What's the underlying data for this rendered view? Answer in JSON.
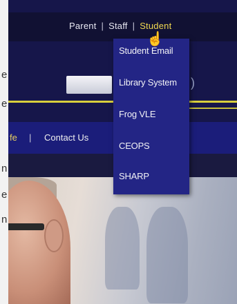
{
  "top_links": {
    "parent": "Parent",
    "staff": "Staff",
    "student": "Student",
    "separator": "|"
  },
  "dropdown": {
    "items": [
      "Student Email",
      "Library System",
      "Frog VLE",
      "CEOPS",
      "SHARP"
    ]
  },
  "nav": {
    "partial_item": "fe",
    "separator": "|",
    "contact": "Contact Us"
  },
  "left_margin_letters": [
    "e",
    "e",
    "n",
    "e",
    "n"
  ],
  "colors": {
    "header_bg": "#16164a",
    "nav_bg": "#1b1d7a",
    "dropdown_bg": "#232585",
    "accent_yellow": "#d8cf3c"
  }
}
